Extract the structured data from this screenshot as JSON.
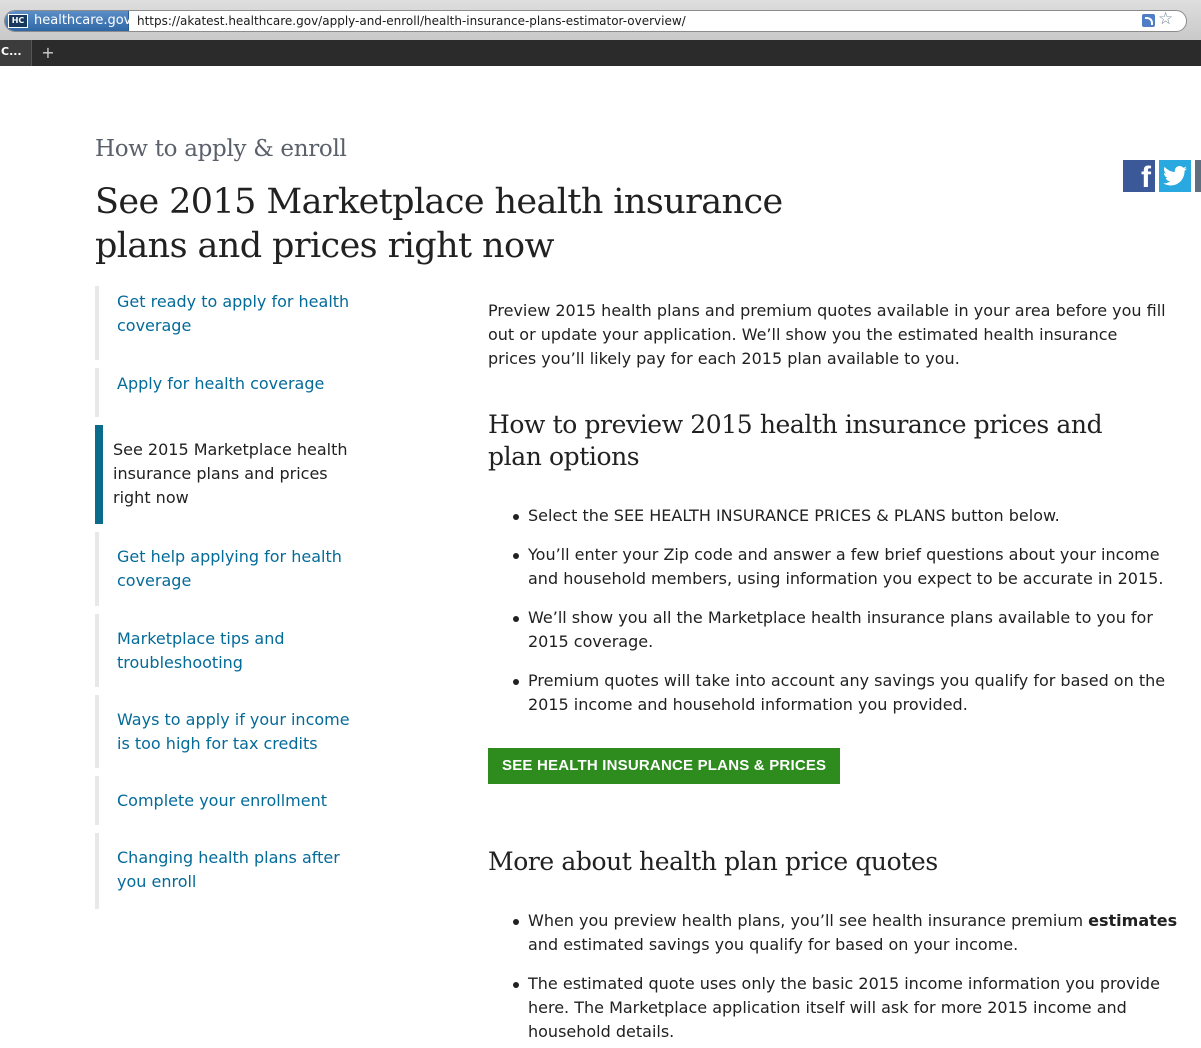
{
  "browser": {
    "site_badge": "healthcare.gov",
    "favicon": "HC",
    "url": "https://akatest.healthcare.gov/apply-and-enroll/health-insurance-plans-estimator-overview/",
    "tab_label": "C...",
    "new_tab": "+",
    "star": "☆"
  },
  "page": {
    "eyebrow": "How to apply & enroll",
    "title": "See 2015 Marketplace health insurance plans and prices right now"
  },
  "social": {
    "facebook_glyph": "f",
    "twitter_glyph": "🐦"
  },
  "sidenav": {
    "items": [
      {
        "label": "Get ready to apply for health coverage"
      },
      {
        "label": "Apply for health coverage"
      },
      {
        "label": "See 2015 Marketplace health insurance plans and prices right now"
      },
      {
        "label": "Get help applying for health coverage"
      },
      {
        "label": "Marketplace tips and troubleshooting"
      },
      {
        "label": "Ways to apply if your income is too high for tax credits"
      },
      {
        "label": "Complete your enrollment"
      },
      {
        "label": "Changing health plans after you enroll"
      }
    ]
  },
  "main": {
    "intro": "Preview 2015 health plans and premium quotes available in your area before you fill out or update your application. We’ll show you the estimated health insurance prices you’ll likely pay for each 2015 plan available to you.",
    "section1_heading": "How to preview 2015 health insurance prices and plan options",
    "section1_bullets": [
      "Select the SEE HEALTH INSURANCE PRICES & PLANS button below.",
      "You’ll enter your Zip code and answer a few brief questions about your income and household members, using information you expect to be accurate in 2015.",
      "We’ll show you all the Marketplace health insurance plans available to you for 2015 coverage.",
      "Premium quotes will take into account any savings you qualify for based on the 2015 income and household information you provided."
    ],
    "cta_label": "SEE HEALTH INSURANCE PLANS & PRICES",
    "section2_heading": "More about health plan price quotes",
    "section2_bullets": [
      {
        "before": "When you preview health plans, you’ll see health insurance premium ",
        "bold": "estimates",
        "after": " and estimated savings you qualify for based on your income."
      },
      {
        "before": "The estimated quote uses only the basic 2015 income information you provide here. The Marketplace application itself will ask for more 2015 income and household details.",
        "bold": "",
        "after": ""
      }
    ]
  },
  "colors": {
    "link": "#046b99",
    "cta_green": "#2e8b1e",
    "active_bar": "#0a6b8c",
    "facebook": "#3b5998",
    "twitter": "#29a9df"
  }
}
